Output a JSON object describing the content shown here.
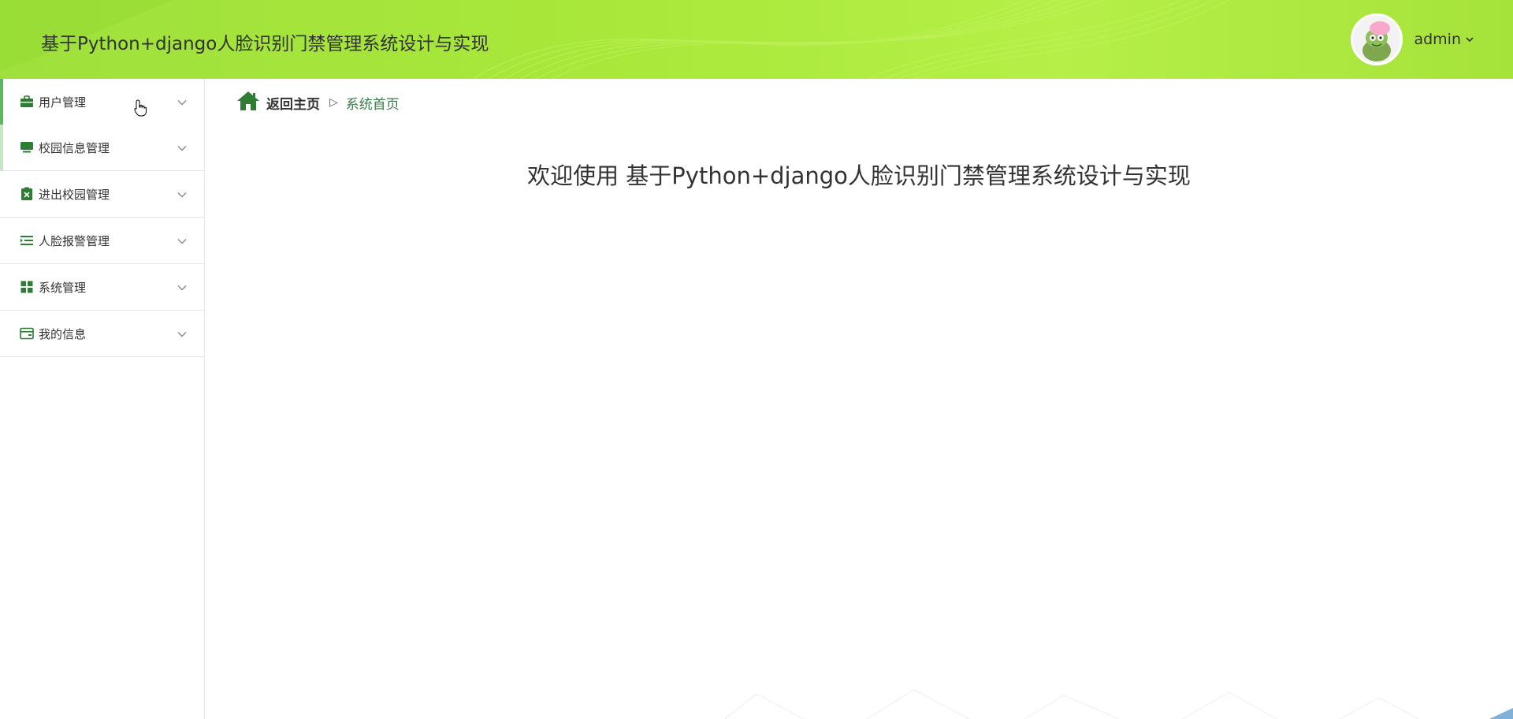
{
  "header": {
    "title": "基于Python+django人脸识别门禁管理系统设计与实现",
    "user": {
      "name": "admin",
      "avatar_icon": "cartoon-avatar-icon"
    }
  },
  "sidebar": {
    "items": [
      {
        "label": "用户管理",
        "icon": "briefcase-icon"
      },
      {
        "label": "校园信息管理",
        "icon": "monitor-icon"
      },
      {
        "label": "进出校园管理",
        "icon": "clipboard-icon"
      },
      {
        "label": "人脸报警管理",
        "icon": "list-indent-icon"
      },
      {
        "label": "系统管理",
        "icon": "grid-icon"
      },
      {
        "label": "我的信息",
        "icon": "wallet-icon"
      }
    ]
  },
  "breadcrumb": {
    "home_label": "返回主页",
    "separator": "▷",
    "current": "系统首页"
  },
  "main": {
    "welcome": "欢迎使用 基于Python+django人脸识别门禁管理系统设计与实现"
  },
  "colors": {
    "header_green": "#a9e83a",
    "icon_green": "#2e7d32",
    "active_bar": "#5cb85c"
  }
}
